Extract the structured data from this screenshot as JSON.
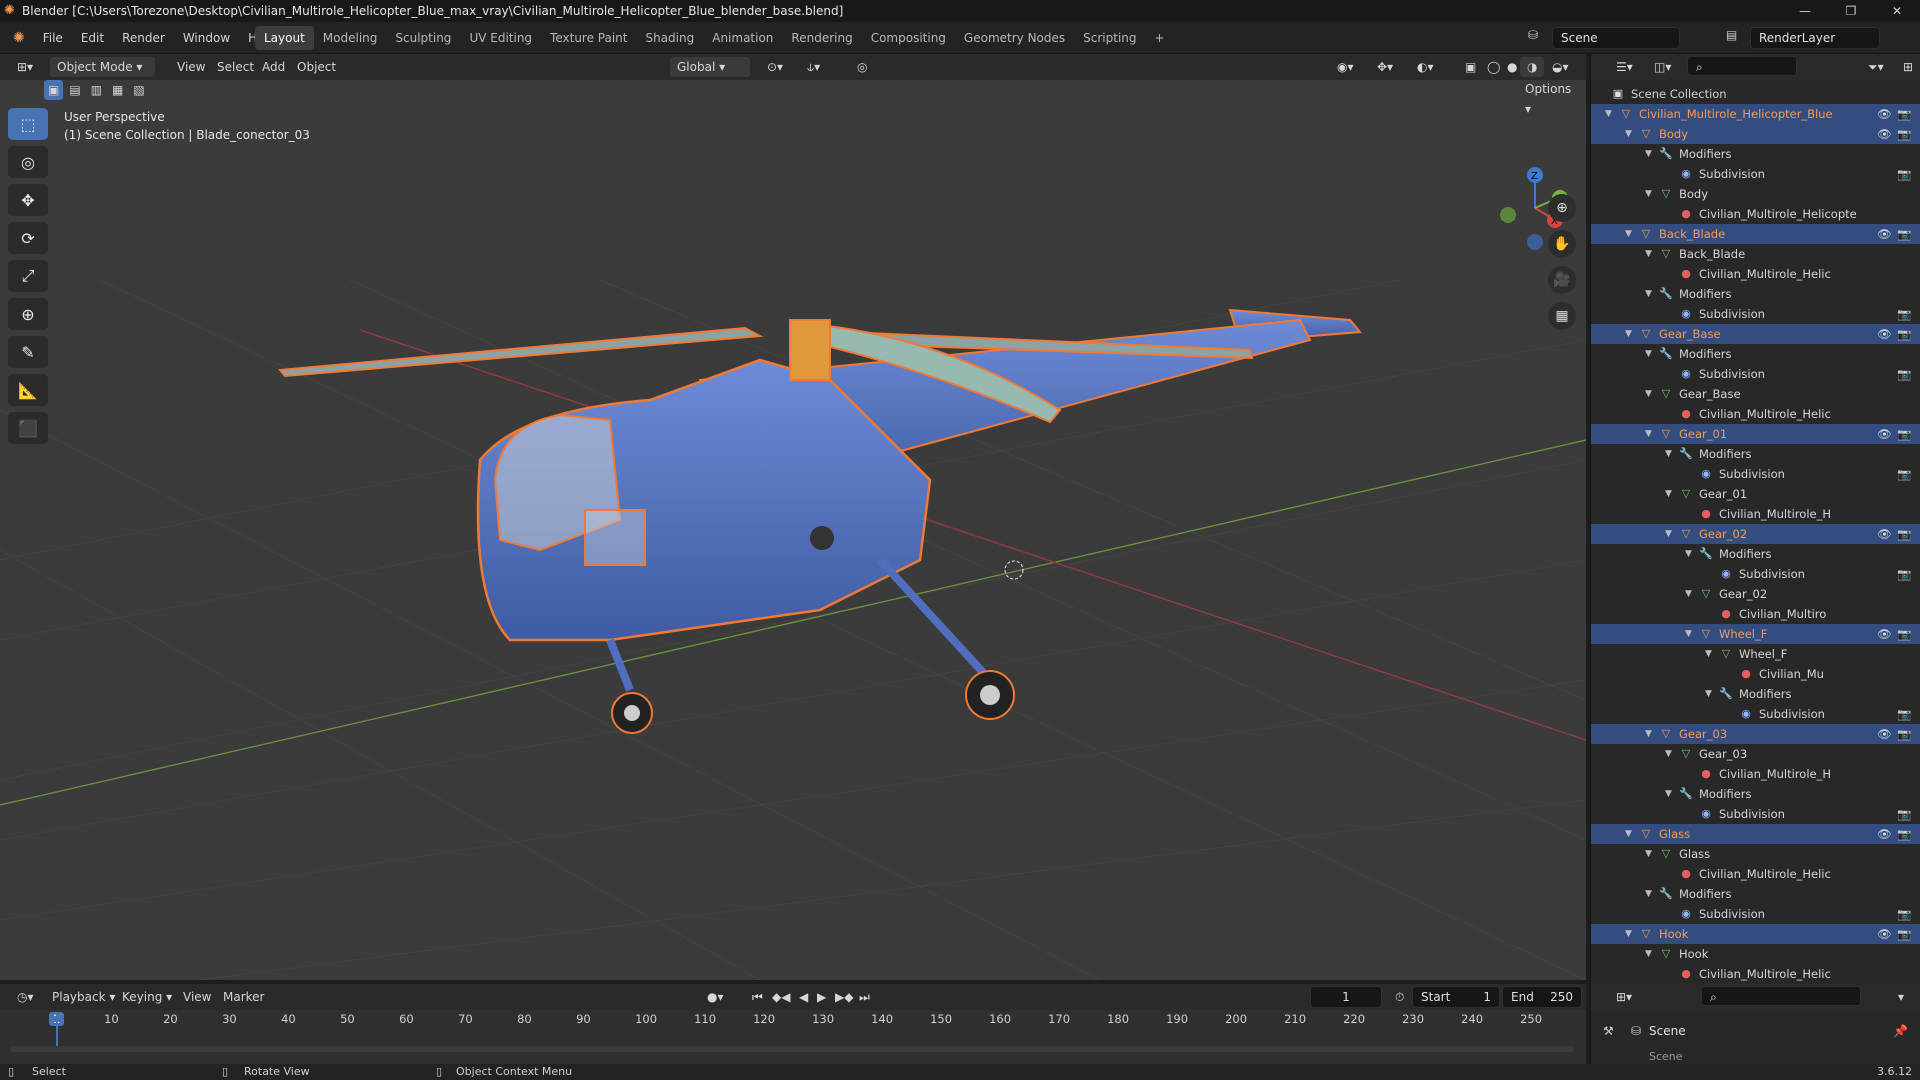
{
  "titlebar": {
    "title": "Blender [C:\\Users\\Torezone\\Desktop\\Civilian_Multirole_Helicopter_Blue_max_vray\\Civilian_Multirole_Helicopter_Blue_blender_base.blend]",
    "minimize": "—",
    "maximize": "❐",
    "close": "✕"
  },
  "menubar": {
    "menus": [
      "File",
      "Edit",
      "Render",
      "Window",
      "Help"
    ],
    "workspaces": [
      "Layout",
      "Modeling",
      "Sculpting",
      "UV Editing",
      "Texture Paint",
      "Shading",
      "Animation",
      "Rendering",
      "Compositing",
      "Geometry Nodes",
      "Scripting"
    ],
    "add_workspace": "+",
    "scene_field": "Scene",
    "renderlayer_field": "RenderLayer"
  },
  "viewport_header": {
    "mode": "Object Mode",
    "menus": [
      "View",
      "Select",
      "Add",
      "Object"
    ],
    "orientation": "Global",
    "options": "Options"
  },
  "viewport": {
    "perspective_label": "User Perspective",
    "context_label": "(1) Scene Collection | Blade_conector_03",
    "gizmo": {
      "x": "X",
      "y": "Y",
      "z": "Z"
    }
  },
  "outliner": {
    "root": "Scene Collection",
    "rows": [
      {
        "label": "Civilian_Multirole_Helicopter_Blue",
        "kind": "obj",
        "depth": 0,
        "selected": true,
        "toggles": true
      },
      {
        "label": "Body",
        "kind": "obj",
        "depth": 1,
        "selected": true,
        "toggles": true
      },
      {
        "label": "Modifiers",
        "kind": "mod",
        "depth": 2,
        "selected": false,
        "toggles": false
      },
      {
        "label": "Subdivision",
        "kind": "sub",
        "depth": 3,
        "selected": false,
        "toggles": "render"
      },
      {
        "label": "Body",
        "kind": "mesh",
        "depth": 2,
        "selected": false,
        "toggles": false
      },
      {
        "label": "Civilian_Multirole_Helicopte",
        "kind": "mat",
        "depth": 3,
        "selected": false,
        "toggles": false
      },
      {
        "label": "Back_Blade",
        "kind": "obj",
        "depth": 1,
        "selected": true,
        "toggles": true
      },
      {
        "label": "Back_Blade",
        "kind": "mesh",
        "depth": 2,
        "selected": false,
        "toggles": false
      },
      {
        "label": "Civilian_Multirole_Helic",
        "kind": "mat",
        "depth": 3,
        "selected": false,
        "toggles": false
      },
      {
        "label": "Modifiers",
        "kind": "mod",
        "depth": 2,
        "selected": false,
        "toggles": false
      },
      {
        "label": "Subdivision",
        "kind": "sub",
        "depth": 3,
        "selected": false,
        "toggles": "render"
      },
      {
        "label": "Gear_Base",
        "kind": "obj",
        "depth": 1,
        "selected": true,
        "toggles": true
      },
      {
        "label": "Modifiers",
        "kind": "mod",
        "depth": 2,
        "selected": false,
        "toggles": false
      },
      {
        "label": "Subdivision",
        "kind": "sub",
        "depth": 3,
        "selected": false,
        "toggles": "render"
      },
      {
        "label": "Gear_Base",
        "kind": "mesh",
        "depth": 2,
        "selected": false,
        "toggles": false
      },
      {
        "label": "Civilian_Multirole_Helic",
        "kind": "mat",
        "depth": 3,
        "selected": false,
        "toggles": false
      },
      {
        "label": "Gear_01",
        "kind": "obj",
        "depth": 2,
        "selected": true,
        "toggles": true
      },
      {
        "label": "Modifiers",
        "kind": "mod",
        "depth": 3,
        "selected": false,
        "toggles": false
      },
      {
        "label": "Subdivision",
        "kind": "sub",
        "depth": 4,
        "selected": false,
        "toggles": "render"
      },
      {
        "label": "Gear_01",
        "kind": "mesh",
        "depth": 3,
        "selected": false,
        "toggles": false
      },
      {
        "label": "Civilian_Multirole_H",
        "kind": "mat",
        "depth": 4,
        "selected": false,
        "toggles": false
      },
      {
        "label": "Gear_02",
        "kind": "obj",
        "depth": 3,
        "selected": true,
        "toggles": true
      },
      {
        "label": "Modifiers",
        "kind": "mod",
        "depth": 4,
        "selected": false,
        "toggles": false
      },
      {
        "label": "Subdivision",
        "kind": "sub",
        "depth": 5,
        "selected": false,
        "toggles": "render"
      },
      {
        "label": "Gear_02",
        "kind": "mesh",
        "depth": 4,
        "selected": false,
        "toggles": false
      },
      {
        "label": "Civilian_Multiro",
        "kind": "mat",
        "depth": 5,
        "selected": false,
        "toggles": false
      },
      {
        "label": "Wheel_F",
        "kind": "obj",
        "depth": 4,
        "selected": true,
        "toggles": true
      },
      {
        "label": "Wheel_F",
        "kind": "mesh",
        "depth": 5,
        "selected": false,
        "toggles": false
      },
      {
        "label": "Civilian_Mu",
        "kind": "mat",
        "depth": 6,
        "selected": false,
        "toggles": false
      },
      {
        "label": "Modifiers",
        "kind": "mod",
        "depth": 5,
        "selected": false,
        "toggles": false
      },
      {
        "label": "Subdivision",
        "kind": "sub",
        "depth": 6,
        "selected": false,
        "toggles": "render"
      },
      {
        "label": "Gear_03",
        "kind": "obj",
        "depth": 2,
        "selected": true,
        "toggles": true
      },
      {
        "label": "Gear_03",
        "kind": "mesh",
        "depth": 3,
        "selected": false,
        "toggles": false
      },
      {
        "label": "Civilian_Multirole_H",
        "kind": "mat",
        "depth": 4,
        "selected": false,
        "toggles": false
      },
      {
        "label": "Modifiers",
        "kind": "mod",
        "depth": 3,
        "selected": false,
        "toggles": false
      },
      {
        "label": "Subdivision",
        "kind": "sub",
        "depth": 4,
        "selected": false,
        "toggles": "render"
      },
      {
        "label": "Glass",
        "kind": "obj",
        "depth": 1,
        "selected": true,
        "toggles": true
      },
      {
        "label": "Glass",
        "kind": "mesh",
        "depth": 2,
        "selected": false,
        "toggles": false
      },
      {
        "label": "Civilian_Multirole_Helic",
        "kind": "mat",
        "depth": 3,
        "selected": false,
        "toggles": false
      },
      {
        "label": "Modifiers",
        "kind": "mod",
        "depth": 2,
        "selected": false,
        "toggles": false
      },
      {
        "label": "Subdivision",
        "kind": "sub",
        "depth": 3,
        "selected": false,
        "toggles": "render"
      },
      {
        "label": "Hook",
        "kind": "obj",
        "depth": 1,
        "selected": true,
        "toggles": true
      },
      {
        "label": "Hook",
        "kind": "mesh",
        "depth": 2,
        "selected": false,
        "toggles": false
      },
      {
        "label": "Civilian_Multirole_Helic",
        "kind": "mat",
        "depth": 3,
        "selected": false,
        "toggles": false
      }
    ]
  },
  "timeline": {
    "menus": [
      "Playback",
      "Keying",
      "View",
      "Marker"
    ],
    "current_frame": "1",
    "start_label": "Start",
    "start_value": "1",
    "end_label": "End",
    "end_value": "250",
    "ticks": [
      "1",
      "10",
      "20",
      "30",
      "40",
      "50",
      "60",
      "70",
      "80",
      "90",
      "100",
      "110",
      "120",
      "130",
      "140",
      "150",
      "160",
      "170",
      "180",
      "190",
      "200",
      "210",
      "220",
      "230",
      "240",
      "250"
    ]
  },
  "properties": {
    "scene_label": "Scene",
    "sub_label": "Scene"
  },
  "statusbar": {
    "select": "Select",
    "rotate": "Rotate View",
    "context": "Object Context Menu",
    "version": "3.6.12"
  },
  "colors": {
    "accent": "#4772b3",
    "selection_outline": "#f07a35",
    "helicopter_blue": "#4f6ebf",
    "outliner_selected": "#334d80"
  }
}
